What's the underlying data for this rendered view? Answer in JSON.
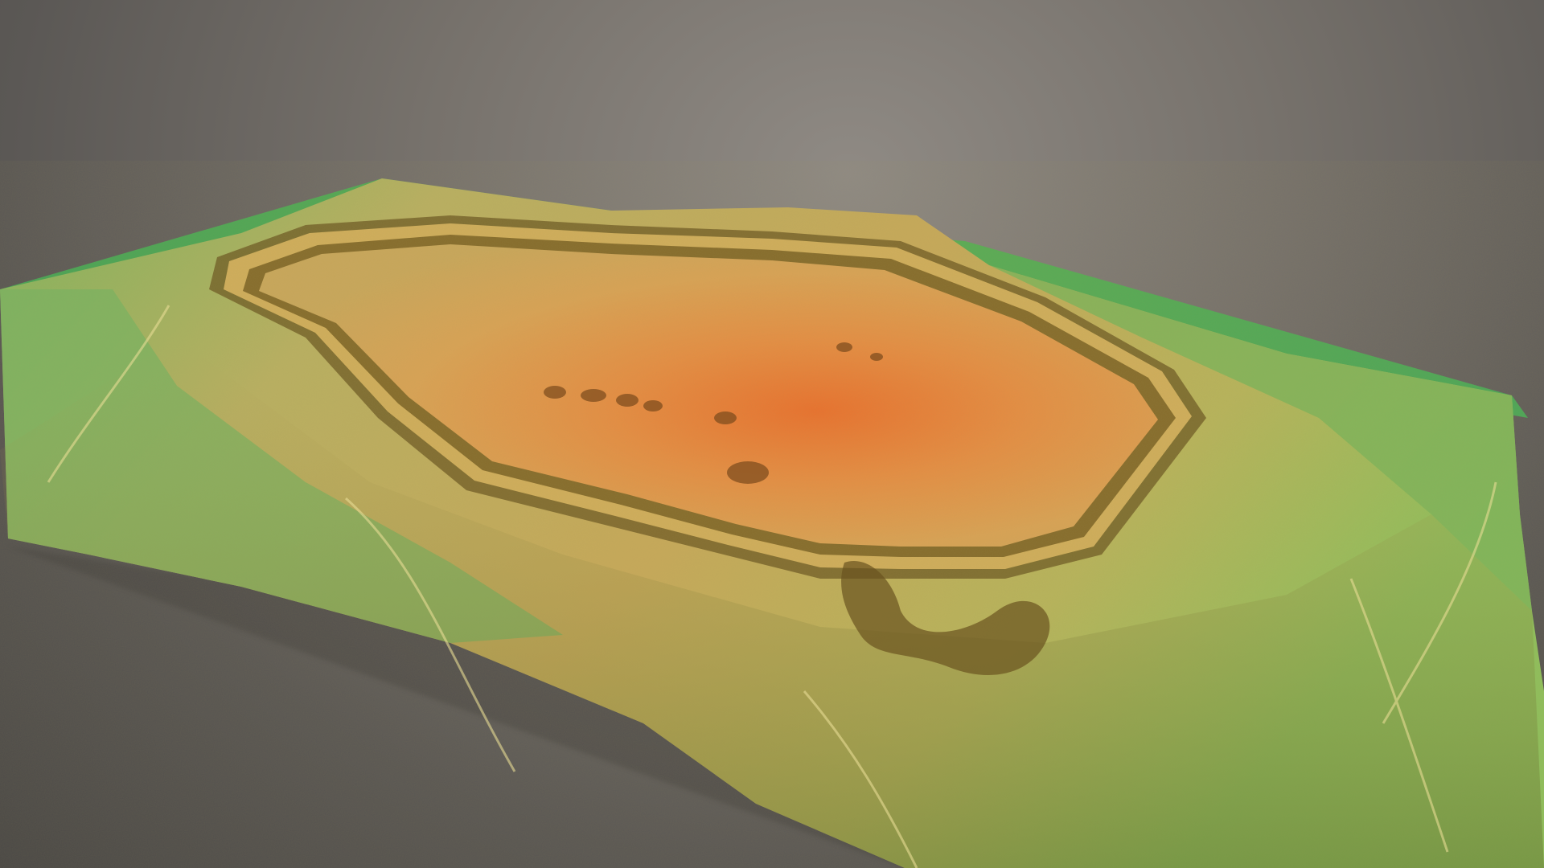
{
  "scene": {
    "subject": "terrain-model",
    "colors": {
      "background_light": "#8f8a84",
      "background_dark": "#4a4846",
      "low_elevation": "#4fa257",
      "mid_elevation": "#c3b66a",
      "high_elevation": "#e98a3a",
      "peak_elevation": "#e5702f",
      "shadow": "#5f4a1c"
    }
  }
}
